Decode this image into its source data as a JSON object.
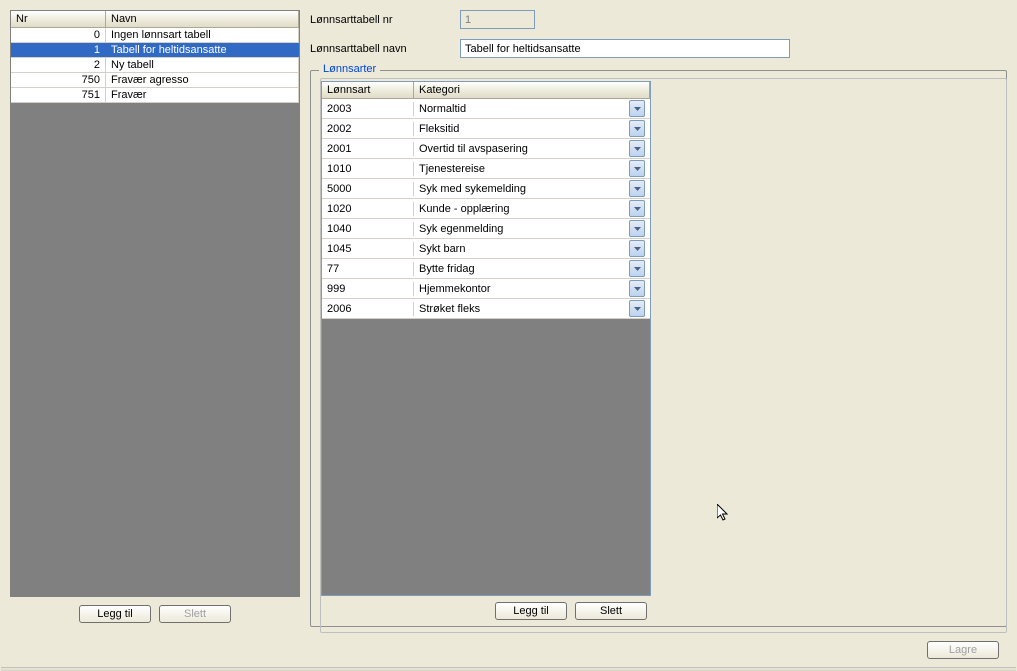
{
  "leftGrid": {
    "headers": {
      "nr": "Nr",
      "navn": "Navn"
    },
    "rows": [
      {
        "nr": "0",
        "navn": "Ingen lønnsart tabell",
        "selected": false
      },
      {
        "nr": "1",
        "navn": "Tabell for heltidsansatte",
        "selected": true
      },
      {
        "nr": "2",
        "navn": "Ny tabell",
        "selected": false
      },
      {
        "nr": "750",
        "navn": "Fravær agresso",
        "selected": false
      },
      {
        "nr": "751",
        "navn": "Fravær",
        "selected": false
      }
    ]
  },
  "form": {
    "nrLabel": "Lønnsarttabell nr",
    "nrValue": "1",
    "navnLabel": "Lønnsarttabell navn",
    "navnValue": "Tabell for heltidsansatte",
    "fieldsetTitle": "Lønnsarter"
  },
  "lonnsarterGrid": {
    "headers": {
      "art": "Lønnsart",
      "kat": "Kategori"
    },
    "rows": [
      {
        "art": "2003",
        "kat": "Normaltid"
      },
      {
        "art": "2002",
        "kat": "Fleksitid"
      },
      {
        "art": "2001",
        "kat": "Overtid til avspasering"
      },
      {
        "art": "1010",
        "kat": "Tjenestereise"
      },
      {
        "art": "5000",
        "kat": "Syk med sykemelding"
      },
      {
        "art": "1020",
        "kat": "Kunde - opplæring"
      },
      {
        "art": "1040",
        "kat": "Syk egenmelding"
      },
      {
        "art": "1045",
        "kat": "Sykt barn"
      },
      {
        "art": "77",
        "kat": "Bytte fridag"
      },
      {
        "art": "999",
        "kat": "Hjemmekontor"
      },
      {
        "art": "2006",
        "kat": "Strøket fleks"
      }
    ]
  },
  "buttons": {
    "leggTil": "Legg til",
    "slett": "Slett",
    "lagre": "Lagre"
  }
}
